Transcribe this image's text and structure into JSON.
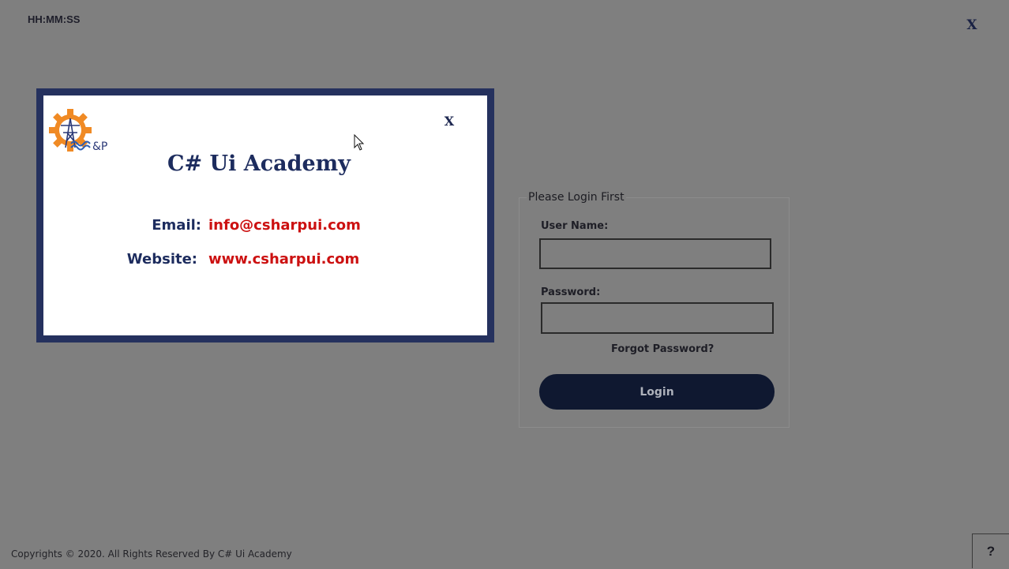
{
  "header": {
    "clock": "HH:MM:SS",
    "close_label": "X"
  },
  "about_dialog": {
    "close_label": "X",
    "title": "C# Ui Academy",
    "logo_text": "&P",
    "email_label": "Email:",
    "email_value": "info@csharpui.com",
    "website_label": "Website:",
    "website_value": "www.csharpui.com",
    "colors": {
      "frame": "#25315e",
      "link": "#cc1111",
      "title": "#1d2c5e"
    }
  },
  "login": {
    "legend": "Please Login First",
    "username_label": "User Name:",
    "username_value": "",
    "password_label": "Password:",
    "password_value": "",
    "forgot_label": "Forgot Password?",
    "login_button": "Login"
  },
  "footer": {
    "copyright": "Copyrights © 2020. All Rights Reserved By C# Ui Academy",
    "help_label": "?"
  }
}
